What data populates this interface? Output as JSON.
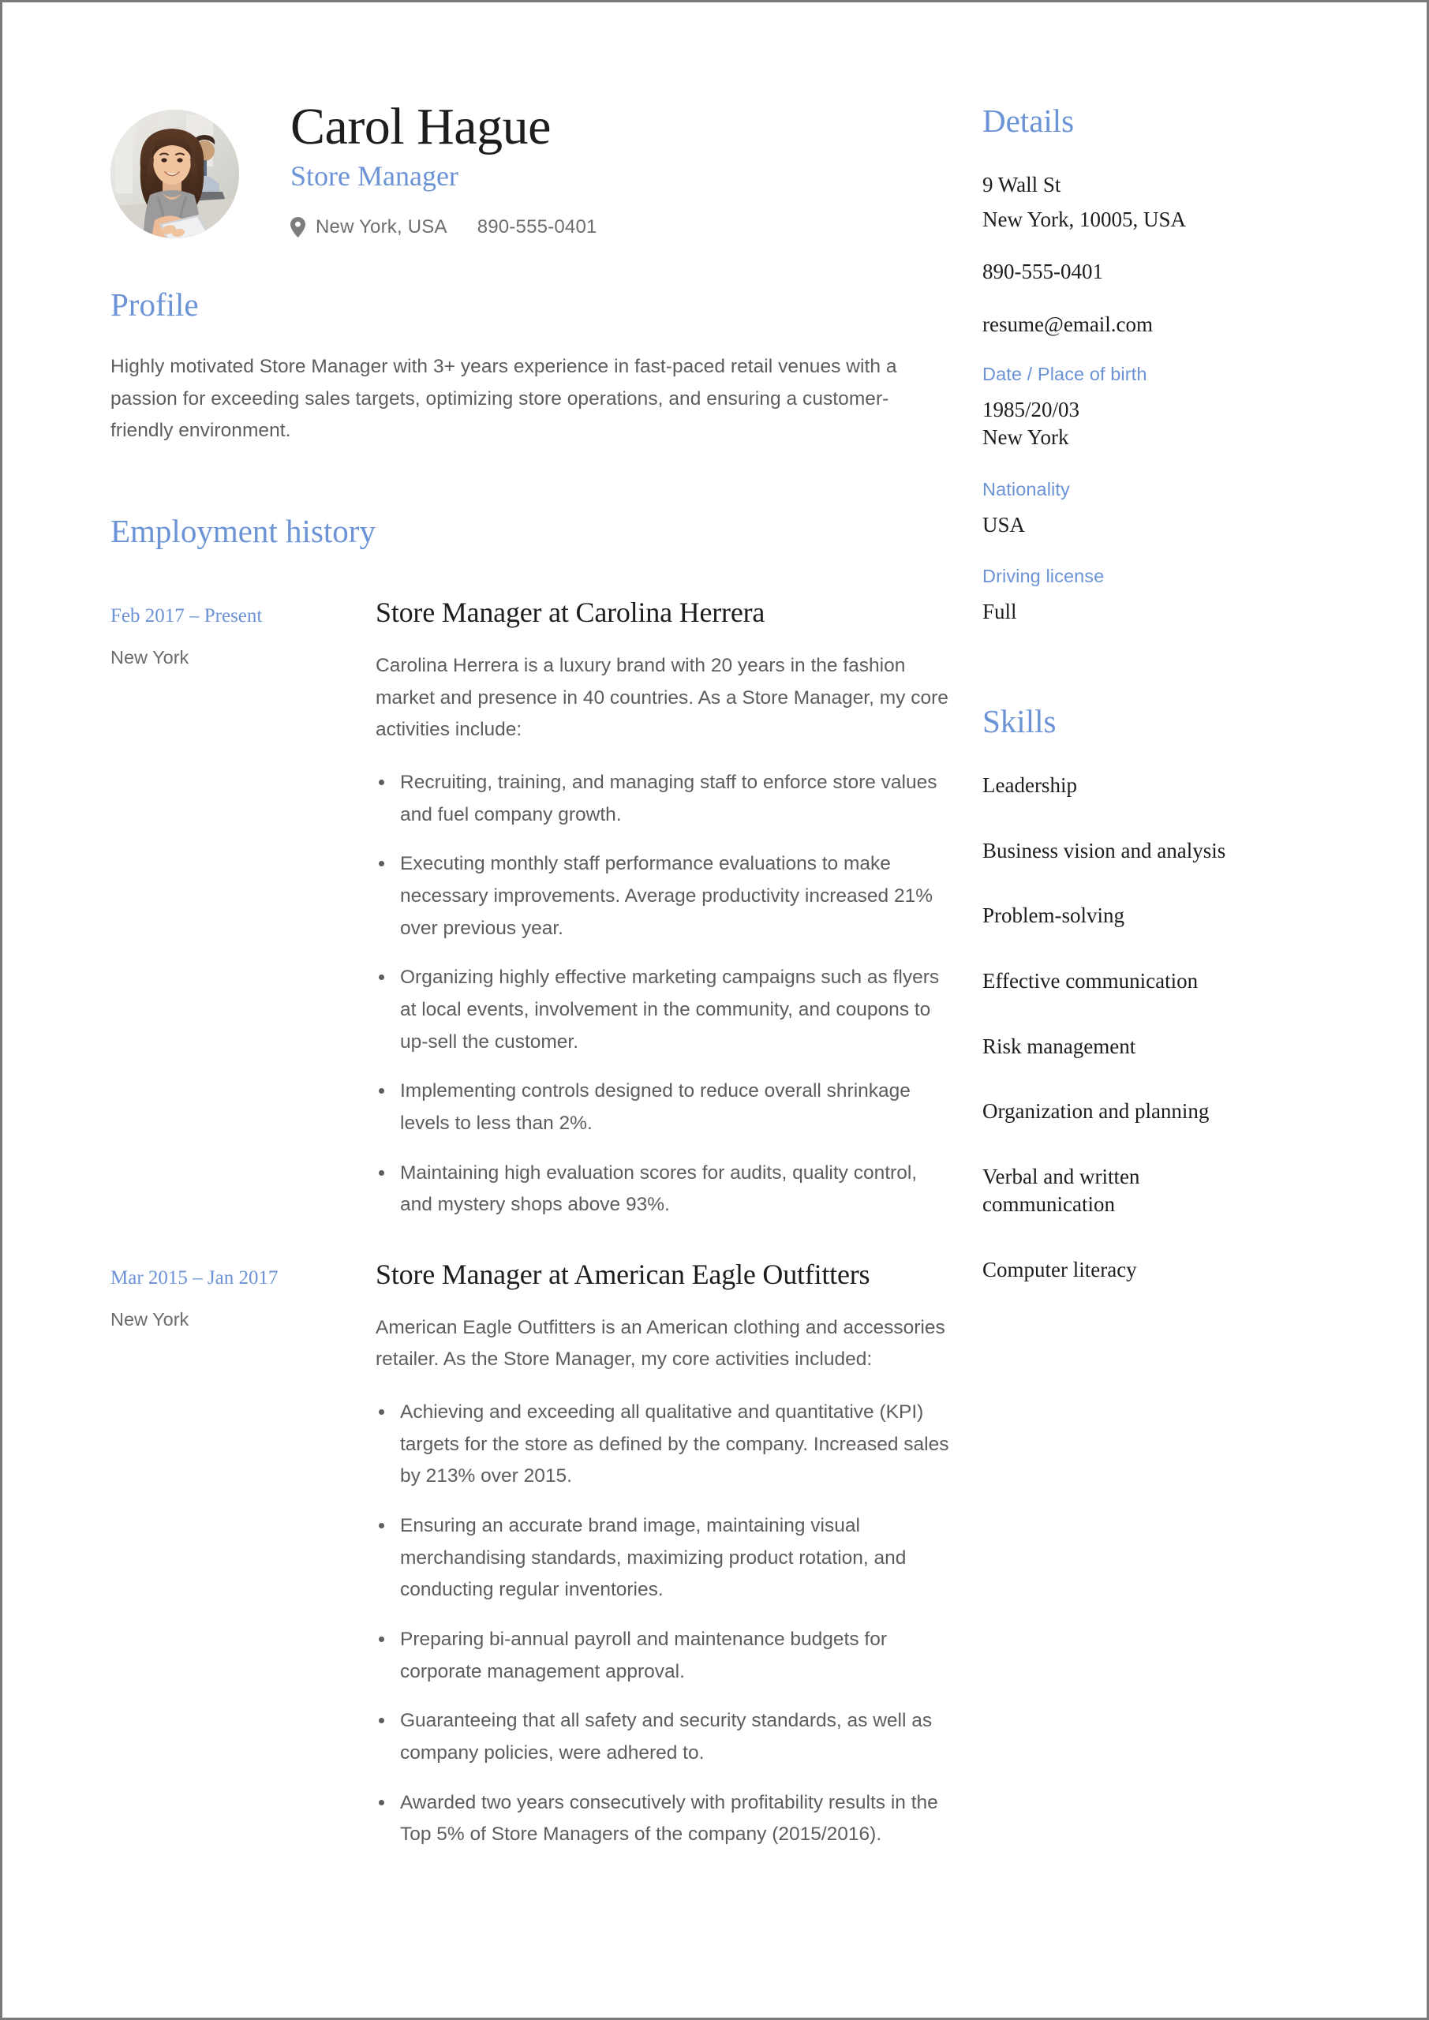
{
  "theme": {
    "accent_blue": "#6b93d6",
    "body_text": "#5d5d5d",
    "heading_text": "#1d1d1d",
    "page_border": "#7a7a7a"
  },
  "header": {
    "name": "Carol Hague",
    "job_title": "Store Manager",
    "location_icon": "location-pin-icon",
    "location": "New York, USA",
    "phone": "890-555-0401",
    "avatar_alt": "woman-with-tablet-in-office-photo"
  },
  "profile": {
    "heading": "Profile",
    "text": "Highly motivated Store Manager with 3+ years experience in fast-paced retail venues with a passion for exceeding sales targets, optimizing store operations, and ensuring a customer-friendly environment."
  },
  "employment": {
    "heading": "Employment history",
    "jobs": [
      {
        "dates": "Feb 2017 – Present",
        "location": "New York",
        "title": "Store Manager at Carolina Herrera",
        "description": "Carolina Herrera is a luxury brand with 20 years in the fashion market and presence in 40 countries. As a Store Manager, my core activities include:",
        "bullets": [
          "Recruiting, training, and managing staff to enforce store values and fuel company growth.",
          "Executing monthly staff performance evaluations to make necessary improvements. Average productivity increased 21% over previous year.",
          "Organizing highly effective marketing campaigns such as flyers at local events, involvement in the community, and coupons to up-sell the customer.",
          "Implementing controls designed to reduce overall shrinkage levels to less than 2%.",
          "Maintaining high evaluation scores for audits, quality control, and mystery shops above 93%."
        ]
      },
      {
        "dates": "Mar 2015 – Jan 2017",
        "location": "New York",
        "title": "Store Manager at American Eagle Outfitters",
        "description": "American Eagle Outfitters is an American clothing and accessories retailer. As the Store Manager, my core activities included:",
        "bullets": [
          "Achieving and exceeding all qualitative and quantitative (KPI) targets for the store as defined by the company. Increased sales by 213% over 2015.",
          "Ensuring an accurate brand image, maintaining visual merchandising standards, maximizing product rotation, and conducting regular inventories.",
          "Preparing bi-annual payroll and maintenance budgets for corporate management approval.",
          "Guaranteeing that all safety and security standards, as well as company policies, were adhered to.",
          "Awarded two years consecutively with profitability results in the Top 5% of Store Managers of the company (2015/2016)."
        ]
      }
    ]
  },
  "details": {
    "heading": "Details",
    "address_line1": "9 Wall St",
    "address_line2": "New York, 10005, USA",
    "phone": "890-555-0401",
    "email": "resume@email.com",
    "birth_label": "Date / Place of birth",
    "birth_value": "1985/20/03\nNew York",
    "nationality_label": "Nationality",
    "nationality_value": "USA",
    "license_label": "Driving license",
    "license_value": "Full"
  },
  "skills": {
    "heading": "Skills",
    "items": [
      "Leadership",
      "Business vision and analysis",
      "Problem-solving",
      "Effective communication",
      "Risk management",
      "Organization and planning",
      "Verbal and written communication",
      "Computer literacy"
    ]
  }
}
